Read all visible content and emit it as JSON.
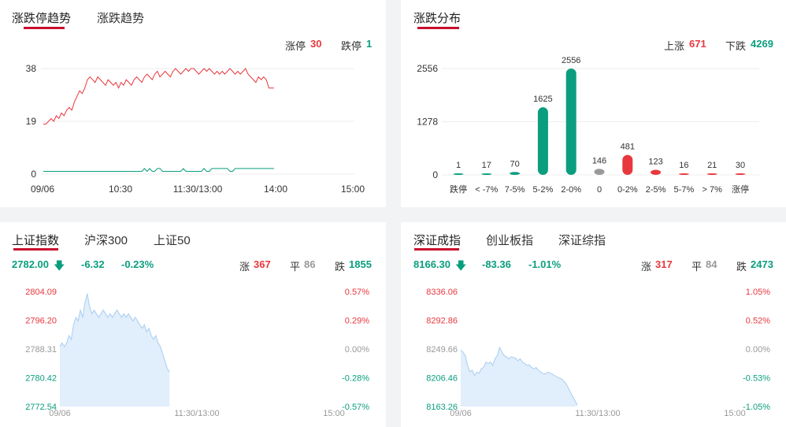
{
  "panel1": {
    "tabs": [
      "涨跌停趋势",
      "涨跌趋势"
    ],
    "limit_up_label": "涨停",
    "limit_up_value": "30",
    "limit_down_label": "跌停",
    "limit_down_value": "1",
    "chart_data": {
      "type": "line",
      "yticks": [
        "38",
        "19",
        "0"
      ],
      "ylim": [
        0,
        38
      ],
      "xticks": [
        "09/06",
        "10:30",
        "11:30/13:00",
        "14:00",
        "15:00"
      ],
      "series": [
        {
          "color": "#e8383d",
          "values": [
            18,
            18,
            19,
            20,
            19,
            21,
            20,
            22,
            21,
            23,
            24,
            23,
            26,
            28,
            30,
            29,
            31,
            34,
            35,
            34,
            33,
            35,
            34,
            33,
            32,
            34,
            33,
            32,
            33,
            31,
            33,
            32,
            34,
            33,
            32,
            34,
            35,
            34,
            33,
            35,
            36,
            35,
            34,
            36,
            37,
            35,
            36,
            37,
            36,
            35,
            37,
            38,
            37,
            36,
            37,
            38,
            37,
            38,
            38,
            37,
            36,
            37,
            38,
            37,
            38,
            37,
            36,
            37,
            36,
            37,
            36,
            37,
            38,
            37,
            36,
            37,
            36,
            37,
            38,
            36,
            35,
            34,
            33,
            35,
            34,
            35,
            34,
            31,
            31,
            31
          ]
        },
        {
          "color": "#0a9e7f",
          "values": [
            1,
            1,
            1,
            1,
            1,
            1,
            1,
            1,
            1,
            1,
            1,
            1,
            1,
            1,
            1,
            1,
            1,
            1,
            1,
            1,
            1,
            1,
            1,
            1,
            1,
            1,
            1,
            1,
            1,
            1,
            1,
            1,
            1,
            1,
            1,
            1,
            1,
            1,
            1,
            2,
            1,
            2,
            1,
            1,
            2,
            2,
            1,
            1,
            1,
            1,
            1,
            1,
            1,
            1,
            2,
            1,
            1,
            1,
            1,
            1,
            1,
            1,
            2,
            1,
            1,
            2,
            2,
            2,
            2,
            2,
            2,
            2,
            1,
            1,
            2,
            2,
            2,
            2,
            2,
            2,
            2,
            2,
            2,
            2,
            2,
            2,
            2,
            2,
            2,
            2
          ]
        }
      ]
    }
  },
  "panel2": {
    "tab": "涨跌分布",
    "up_label": "上涨",
    "up_value": "671",
    "down_label": "下跌",
    "down_value": "4269",
    "chart_data": {
      "type": "bar",
      "yticks": [
        "2556",
        "1278",
        "0"
      ],
      "ylim": [
        0,
        2556
      ],
      "categories": [
        "跌停",
        "< -7%",
        "7-5%",
        "5-2%",
        "2-0%",
        "0",
        "0-2%",
        "2-5%",
        "5-7%",
        "> 7%",
        "涨停"
      ],
      "values": [
        1,
        17,
        70,
        1625,
        2556,
        146,
        481,
        123,
        16,
        21,
        30
      ],
      "colors": [
        "#0a9e7f",
        "#0a9e7f",
        "#0a9e7f",
        "#0a9e7f",
        "#0a9e7f",
        "#999999",
        "#e8383d",
        "#e8383d",
        "#e8383d",
        "#e8383d",
        "#e8383d"
      ]
    }
  },
  "panel3": {
    "tabs": [
      "上证指数",
      "沪深300",
      "上证50"
    ],
    "price": "2782.00",
    "change": "-6.32",
    "change_pct": "-0.23%",
    "up_label": "涨",
    "up_value": "367",
    "flat_label": "平",
    "flat_value": "86",
    "down_label": "跌",
    "down_value": "1855",
    "chart_data": {
      "type": "area",
      "ylim": [
        2772.54,
        2804.09
      ],
      "yticks_left": [
        "2804.09",
        "2796.20",
        "2788.31",
        "2780.42",
        "2772.54"
      ],
      "yticks_right": [
        "0.57%",
        "0.29%",
        "0.00%",
        "-0.28%",
        "-0.57%"
      ],
      "xticks": [
        "09/06",
        "11:30/13:00",
        "15:00"
      ],
      "values": [
        2789,
        2790,
        2789,
        2790,
        2792,
        2791,
        2795,
        2797,
        2796,
        2799,
        2797,
        2801,
        2803.5,
        2800,
        2798,
        2799,
        2798,
        2797,
        2798,
        2799,
        2798,
        2797,
        2798,
        2797,
        2798,
        2799,
        2798,
        2797,
        2798,
        2797,
        2798,
        2797,
        2796,
        2797,
        2796,
        2795,
        2794,
        2795,
        2793,
        2794,
        2792,
        2791,
        2792,
        2790,
        2789,
        2787,
        2785,
        2783,
        2782
      ]
    }
  },
  "panel4": {
    "tabs": [
      "深证成指",
      "创业板指",
      "深证综指"
    ],
    "price": "8166.30",
    "change": "-83.36",
    "change_pct": "-1.01%",
    "up_label": "涨",
    "up_value": "317",
    "flat_label": "平",
    "flat_value": "84",
    "down_label": "跌",
    "down_value": "2473",
    "chart_data": {
      "type": "area",
      "ylim": [
        8163.26,
        8336.06
      ],
      "yticks_left": [
        "8336.06",
        "8292.86",
        "8249.66",
        "8206.46",
        "8163.26"
      ],
      "yticks_right": [
        "1.05%",
        "0.52%",
        "0.00%",
        "-0.53%",
        "-1.05%"
      ],
      "xticks": [
        "09/06",
        "11:30/13:00",
        "15:00"
      ],
      "values": [
        8248,
        8245,
        8240,
        8225,
        8215,
        8218,
        8210,
        8215,
        8213,
        8220,
        8222,
        8230,
        8228,
        8230,
        8225,
        8235,
        8240,
        8252,
        8245,
        8240,
        8238,
        8235,
        8238,
        8237,
        8236,
        8232,
        8235,
        8230,
        8228,
        8225,
        8226,
        8222,
        8220,
        8222,
        8218,
        8215,
        8213,
        8212,
        8215,
        8214,
        8212,
        8210,
        8208,
        8206,
        8205,
        8202,
        8198,
        8192,
        8185,
        8178,
        8172,
        8166
      ]
    }
  },
  "colors": {
    "up": "#e8383d",
    "down": "#0a9e7f",
    "flat": "#999999",
    "accent": "#c8102e",
    "area_fill": "#e1eefb",
    "area_line": "#a8cdf0"
  }
}
